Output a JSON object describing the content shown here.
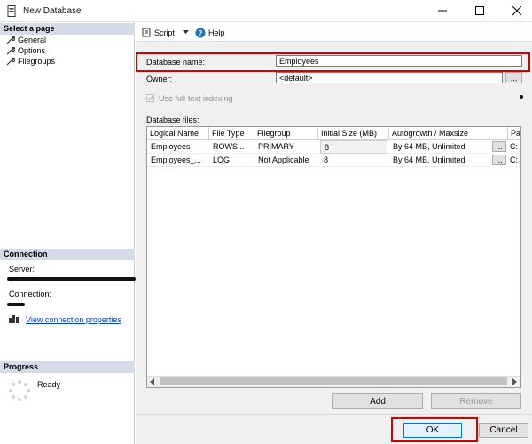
{
  "window": {
    "title": "New Database"
  },
  "left_panel": {
    "select_page_header": "Select a page",
    "pages": [
      {
        "label": "General"
      },
      {
        "label": "Options"
      },
      {
        "label": "Filegroups"
      }
    ],
    "connection_header": "Connection",
    "server_label": "Server:",
    "connection_label": "Connection:",
    "view_connection_link": "View connection properties",
    "progress_header": "Progress",
    "progress_status": "Ready"
  },
  "toolbar": {
    "script_label": "Script",
    "help_label": "Help"
  },
  "form": {
    "database_name_label": "Database name:",
    "database_name_value": "Employees",
    "owner_label": "Owner:",
    "owner_value": "<default>",
    "browse_label": "...",
    "full_text_label": "Use full-text indexing",
    "database_files_label": "Database files:"
  },
  "grid": {
    "columns": [
      "Logical Name",
      "File Type",
      "Filegroup",
      "Initial Size (MB)",
      "Autogrowth / Maxsize",
      "Pa"
    ],
    "rows": [
      {
        "logical_name": "Employees",
        "file_type": "ROWS...",
        "filegroup": "PRIMARY",
        "initial_size": "8",
        "autogrowth": "By 64 MB, Unlimited",
        "btn": "...",
        "path": "C:"
      },
      {
        "logical_name": "Employees_...",
        "file_type": "LOG",
        "filegroup": "Not Applicable",
        "initial_size": "8",
        "autogrowth": "By 64 MB, Unlimited",
        "btn": "...",
        "path": "C:"
      }
    ]
  },
  "buttons": {
    "add": "Add",
    "remove": "Remove",
    "ok": "OK",
    "cancel": "Cancel"
  },
  "colors": {
    "highlight_red": "#d40000",
    "section_header": "#d6dbe9",
    "link_blue": "#0645ad"
  }
}
